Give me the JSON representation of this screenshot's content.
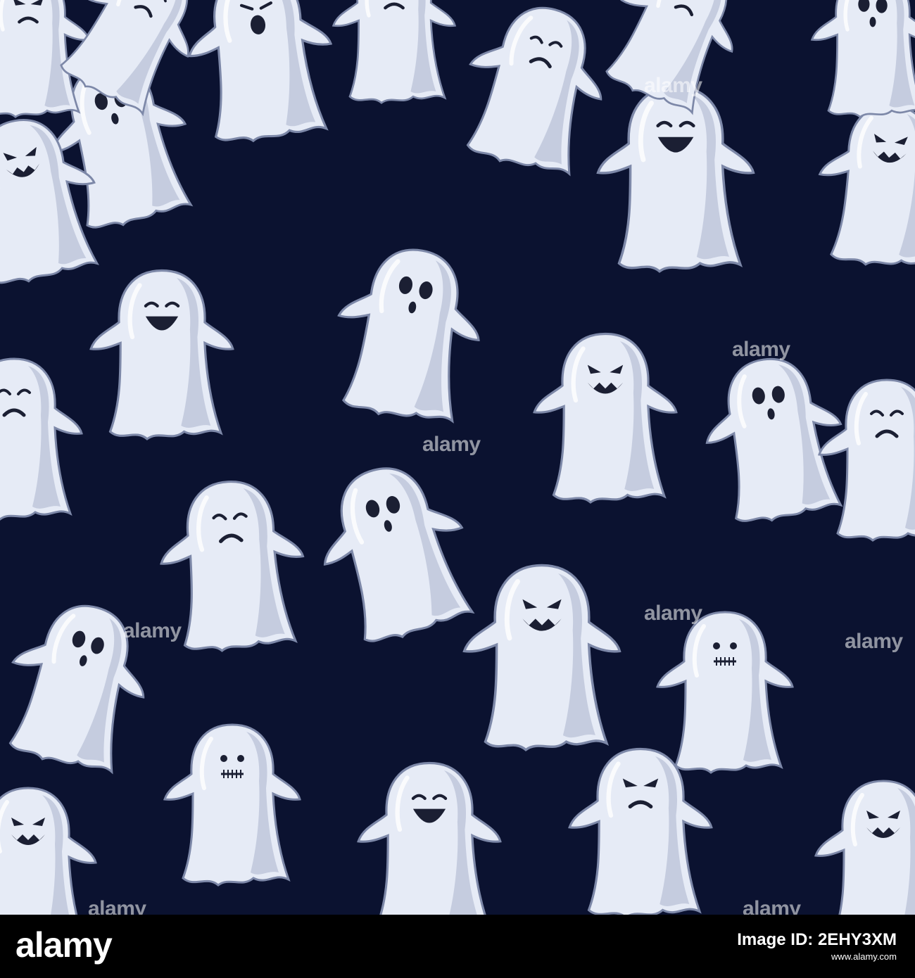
{
  "colors": {
    "background": "#0b1230",
    "ghost_body": "#e6ebf6",
    "ghost_shadow": "#aab3cc",
    "ghost_outline": "#7d88a8",
    "face": "#1b1f33",
    "footer_background": "#000000",
    "footer_text": "#ffffff"
  },
  "watermark": {
    "text": "alamy"
  },
  "footer": {
    "logo": "alamy",
    "image_id_label": "Image ID: 2EHY3XM",
    "url": "www.alamy.com"
  },
  "ghosts": [
    {
      "name": "ghost-screaming",
      "expression": "screaming"
    },
    {
      "name": "ghost-skull-face",
      "expression": "surprised"
    },
    {
      "name": "ghost-sad",
      "expression": "sad"
    },
    {
      "name": "ghost-laughing",
      "expression": "laughing"
    },
    {
      "name": "ghost-evil-grin",
      "expression": "evil-grin"
    },
    {
      "name": "ghost-stitched-mouth",
      "expression": "stitched"
    },
    {
      "name": "ghost-angry",
      "expression": "angry"
    }
  ]
}
